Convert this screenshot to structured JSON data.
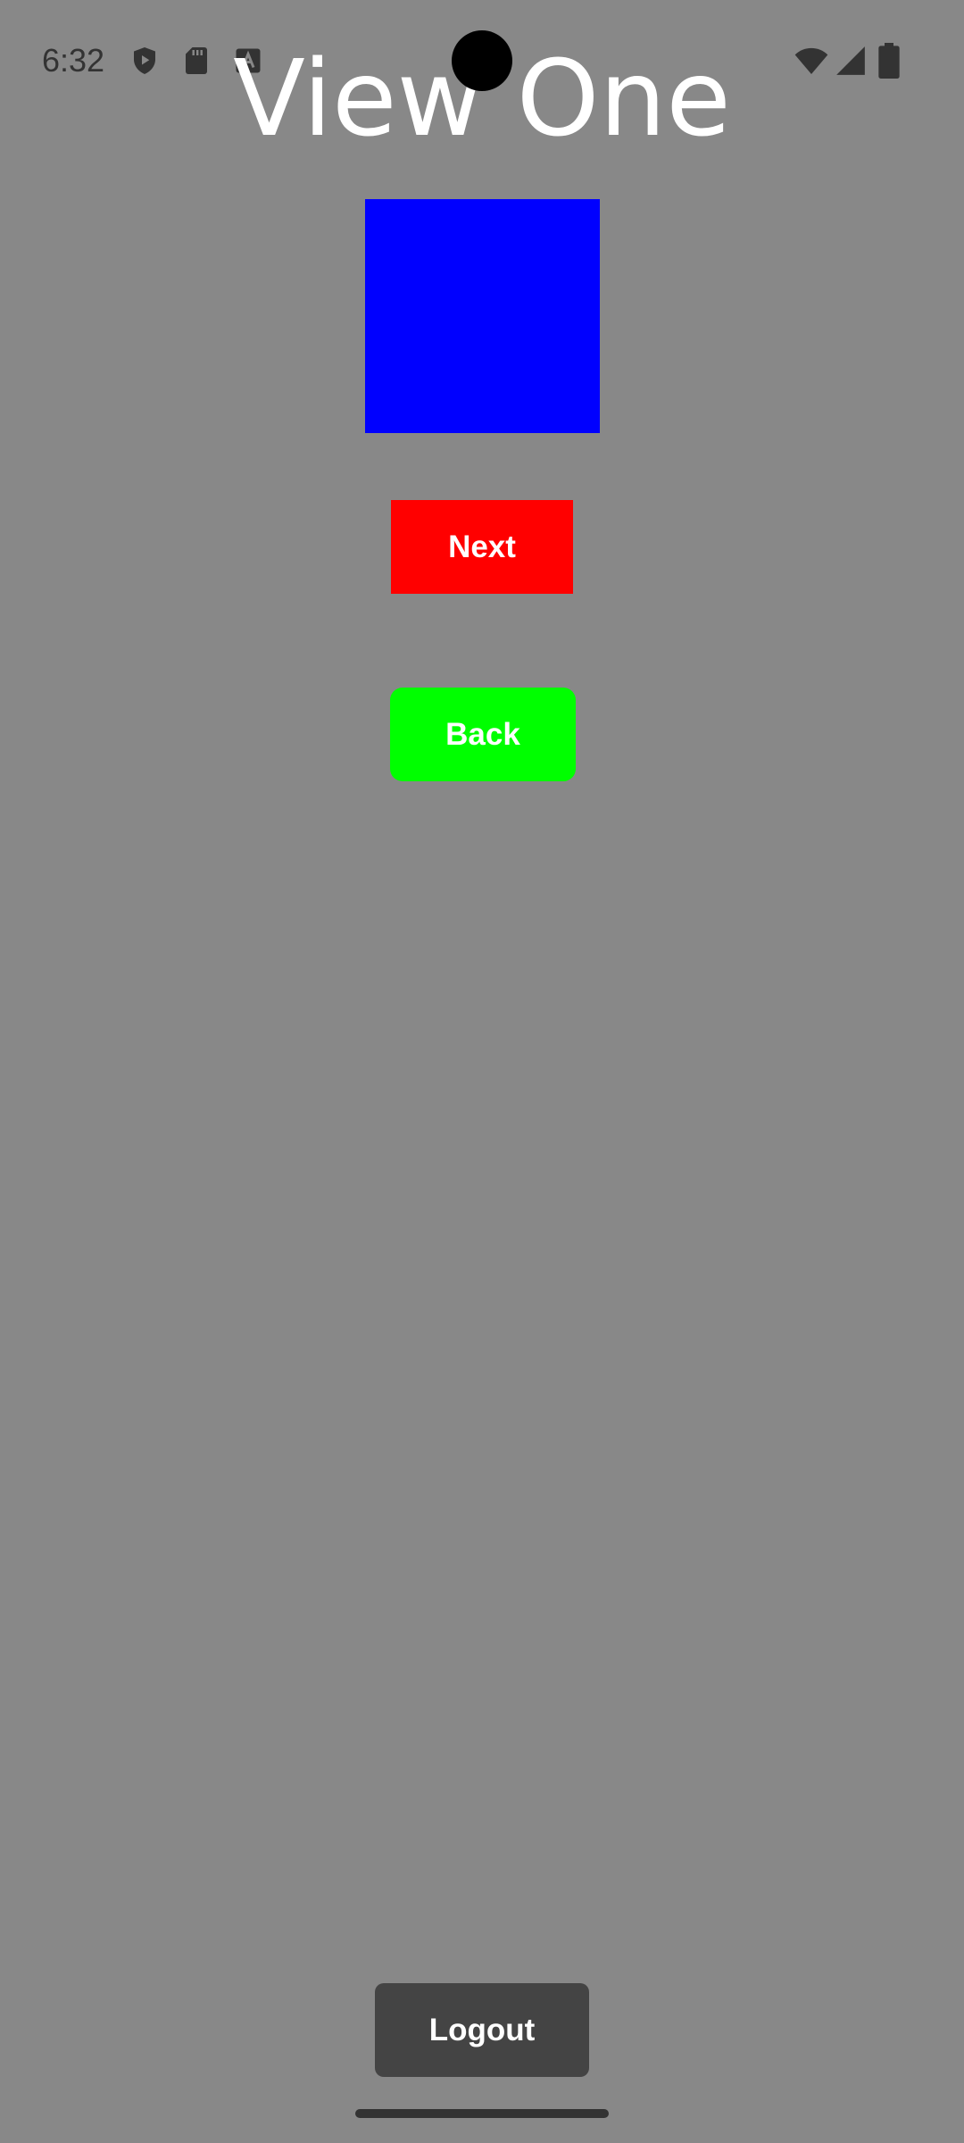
{
  "status_bar": {
    "time": "6:32",
    "left_icons": [
      "shield-play-icon",
      "sd-card-icon",
      "font-a-icon"
    ],
    "right_icons": [
      "wifi-icon",
      "signal-icon",
      "battery-icon"
    ]
  },
  "page": {
    "title": "View One"
  },
  "colors": {
    "background": "#888888",
    "square": "#0000ff",
    "next": "#ff0000",
    "back": "#00ff00",
    "logout": "#444444"
  },
  "buttons": {
    "next_label": "Next",
    "back_label": "Back",
    "logout_label": "Logout"
  }
}
